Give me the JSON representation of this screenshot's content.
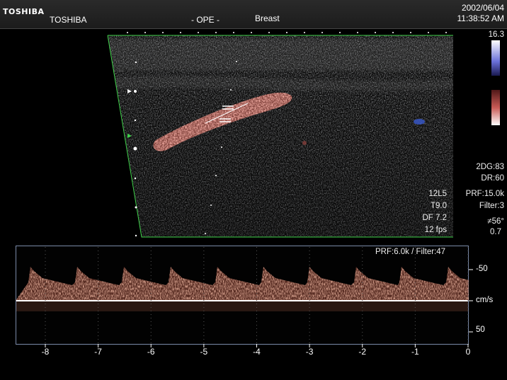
{
  "header": {
    "logo_text": "TOSHIBA",
    "brand": "TOSHIBA",
    "mode": "- OPE -",
    "preset": "Breast",
    "date": "2002/06/04",
    "time": "11:38:52 AM"
  },
  "color_bar": {
    "max_label": "16.3"
  },
  "image_params": {
    "probe": "12L5",
    "tis": "T9.0",
    "df": "DF 7.2",
    "fps": "12 fps"
  },
  "color_params": {
    "gain": "2DG:83",
    "dr": "DR:60",
    "prf": "PRF:15.0k",
    "filter": "Filter:3",
    "angle": "56°",
    "gate": "0.7"
  },
  "spectral": {
    "info": "PRF:6.0k / Filter:47",
    "scale_top": "-50",
    "unit": "cm/s",
    "scale_bottom": "50",
    "time_ticks": [
      "-8",
      "-7",
      "-6",
      "-5",
      "-4",
      "-3",
      "-2",
      "-1",
      "0"
    ]
  },
  "colors": {
    "flow_red": "#e06a5a",
    "flow_blue": "#3a5ad0",
    "sector_outline": "#3fd24a",
    "doppler_trace": "#e08060"
  }
}
